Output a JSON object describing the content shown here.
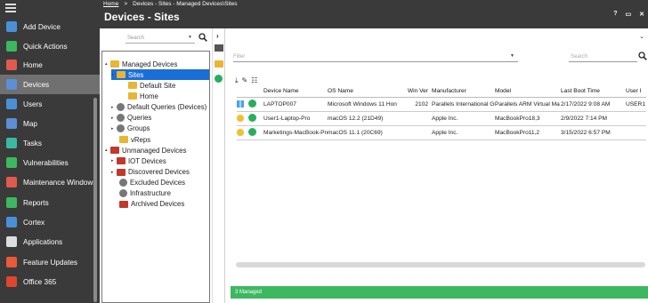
{
  "nav": {
    "items": [
      {
        "label": "Add Device",
        "icon": "add-device-icon",
        "color": "#4a90d9"
      },
      {
        "label": "Quick Actions",
        "icon": "plus-icon",
        "color": "#3cb861"
      },
      {
        "label": "Home",
        "icon": "home-icon",
        "color": "#e05a4f"
      },
      {
        "label": "Devices",
        "icon": "monitor-icon",
        "color": "#5b8fd6",
        "active": true
      },
      {
        "label": "Users",
        "icon": "users-icon",
        "color": "#4a90d9"
      },
      {
        "label": "Map",
        "icon": "map-icon",
        "color": "#5b8fd6"
      },
      {
        "label": "Tasks",
        "icon": "tasks-icon",
        "color": "#3cb8a0"
      },
      {
        "label": "Vulnerabilities",
        "icon": "shield-icon",
        "color": "#3cb861"
      },
      {
        "label": "Maintenance Windows",
        "icon": "wrench-icon",
        "color": "#e05a4f"
      },
      {
        "label": "Reports",
        "icon": "reports-icon",
        "color": "#3cb861"
      },
      {
        "label": "Cortex",
        "icon": "cortex-icon",
        "color": "#4a90d9"
      },
      {
        "label": "Applications",
        "icon": "applications-icon",
        "color": "#dddddd"
      },
      {
        "label": "Feature Updates",
        "icon": "feature-updates-icon",
        "color": "#e85a3a"
      },
      {
        "label": "Office 365",
        "icon": "office-icon",
        "color": "#e0452f"
      }
    ]
  },
  "header": {
    "breadcrumb_home": "Home",
    "breadcrumb_sep": ">",
    "breadcrumb_path": "Devices - Sites - Managed Devices\\Sites",
    "title": "Devices - Sites",
    "icons": [
      "?",
      "▭",
      "✕"
    ]
  },
  "tree": {
    "search_placeholder": "Search",
    "nodes": [
      {
        "label": "Managed Devices",
        "twisty": "▴",
        "icon": "folder-icon",
        "kind": "fold-y"
      },
      {
        "label": "Sites",
        "twisty": "▴",
        "icon": "folder-icon",
        "kind": "fold-y",
        "selected": true
      },
      {
        "label": "Default Site",
        "twisty": "",
        "icon": "folder-icon",
        "kind": "fold-y"
      },
      {
        "label": "Home",
        "twisty": "",
        "icon": "folder-icon",
        "kind": "fold-y"
      },
      {
        "label": "Default Queries (Devices)",
        "twisty": "▸",
        "icon": "gear-icon",
        "kind": "gear"
      },
      {
        "label": "Queries",
        "twisty": "▸",
        "icon": "gear-icon",
        "kind": "gear"
      },
      {
        "label": "Groups",
        "twisty": "▸",
        "icon": "gear-icon",
        "kind": "gear"
      },
      {
        "label": "vReps",
        "twisty": "",
        "icon": "vreps-icon",
        "kind": "fold-y"
      },
      {
        "label": "Unmanaged Devices",
        "twisty": "▴",
        "icon": "unmanaged-icon",
        "kind": "fold-r"
      },
      {
        "label": "IOT Devices",
        "twisty": "▸",
        "icon": "iot-icon",
        "kind": "fold-r"
      },
      {
        "label": "Discovered Devices",
        "twisty": "▸",
        "icon": "discovered-icon",
        "kind": "fold-r"
      },
      {
        "label": "Excluded Devices",
        "twisty": "",
        "icon": "excluded-icon",
        "kind": "gear"
      },
      {
        "label": "Infrastructure",
        "twisty": "",
        "icon": "infrastructure-icon",
        "kind": "gear"
      },
      {
        "label": "Archived Devices",
        "twisty": "",
        "icon": "archive-icon",
        "kind": "fold-r"
      }
    ]
  },
  "main": {
    "filter_placeholder": "Filter",
    "search_placeholder": "Search",
    "toolbar_icons": [
      "⤓",
      "✎",
      "☷"
    ],
    "columns": [
      "Device Name",
      "OS Name",
      "Win Ver",
      "Manufacturer",
      "Model",
      "Last Boot Time",
      "User I"
    ],
    "rows": [
      {
        "os": "windows",
        "name": "LAPTOP007",
        "os_name": "Microsoft Windows 11 Hon",
        "win_ver": "2102",
        "manufacturer": "Parallels International Gm",
        "model": "Parallels ARM Virtual Ma",
        "boot": "2/17/2022 9:08 AM",
        "user": "USER1"
      },
      {
        "os": "apple",
        "name": "User1-Laptop-Pro",
        "os_name": "macOS 12.2 (21D49)",
        "win_ver": "",
        "manufacturer": "Apple Inc.",
        "model": "MacBookPro18,3",
        "boot": "2/9/2022 7:14 PM",
        "user": ""
      },
      {
        "os": "apple",
        "name": "Marketings-MacBook-Pro",
        "os_name": "macOS 11.1 (20C69)",
        "win_ver": "",
        "manufacturer": "Apple Inc.",
        "model": "MacBookPro11,2",
        "boot": "3/15/2022 6:57 PM",
        "user": ""
      }
    ],
    "status": "3 Managed"
  }
}
